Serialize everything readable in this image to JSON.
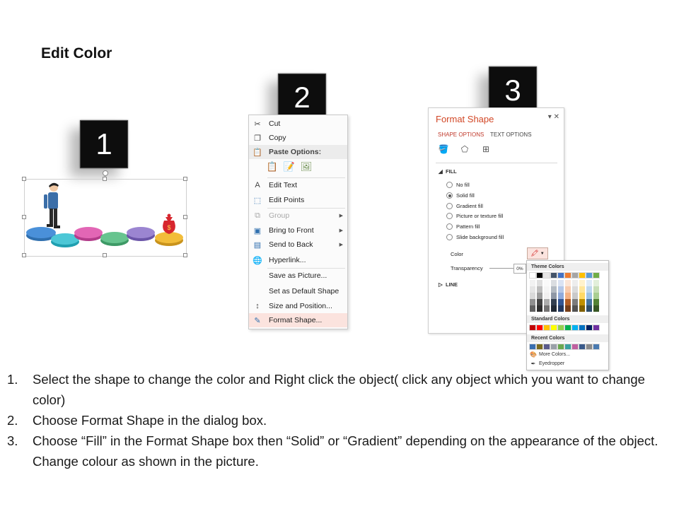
{
  "page": {
    "title": "Edit Color"
  },
  "badges": [
    "1",
    "2",
    "3"
  ],
  "illustration": {
    "money_bag_symbol": "$"
  },
  "context_menu": {
    "items": [
      {
        "label": "Cut",
        "icon": "scissors-icon"
      },
      {
        "label": "Copy",
        "icon": "copy-icon"
      },
      {
        "label": "Paste Options:",
        "icon": "paste-icon"
      },
      {
        "label": "Edit Text",
        "icon": "edit-text-icon"
      },
      {
        "label": "Edit Points",
        "icon": "edit-points-icon"
      },
      {
        "label": "Group",
        "icon": "group-icon"
      },
      {
        "label": "Bring to Front",
        "icon": "bring-front-icon"
      },
      {
        "label": "Send to Back",
        "icon": "send-back-icon"
      },
      {
        "label": "Hyperlink...",
        "icon": "hyperlink-icon"
      },
      {
        "label": "Save as Picture...",
        "icon": ""
      },
      {
        "label": "Set as Default Shape",
        "icon": ""
      },
      {
        "label": "Size and Position...",
        "icon": "size-position-icon"
      },
      {
        "label": "Format Shape...",
        "icon": "format-shape-icon"
      }
    ]
  },
  "format_shape": {
    "title": "Format Shape",
    "tabs": [
      "SHAPE OPTIONS",
      "TEXT OPTIONS"
    ],
    "fill_section": "FILL",
    "fill_options": [
      "No fill",
      "Solid fill",
      "Gradient fill",
      "Picture or texture fill",
      "Pattern fill",
      "Slide background fill"
    ],
    "selected_fill": "Solid fill",
    "color_label": "Color",
    "transparency_label": "Transparency",
    "transparency_value": "0%",
    "line_section": "LINE"
  },
  "color_popup": {
    "theme_header": "Theme Colors",
    "standard_header": "Standard Colors",
    "recent_header": "Recent Colors",
    "more_colors": "More Colors...",
    "eyedropper": "Eyedropper",
    "theme_top": [
      "#ffffff",
      "#000000",
      "#e7e6e6",
      "#44546a",
      "#4472c4",
      "#ed7d31",
      "#a5a5a5",
      "#ffc000",
      "#5b9bd5",
      "#70ad47"
    ],
    "standard": [
      "#c00000",
      "#ff0000",
      "#ffc000",
      "#ffff00",
      "#92d050",
      "#00b050",
      "#00b0f0",
      "#0070c0",
      "#002060",
      "#7030a0"
    ],
    "recent": [
      "#3a6fb0",
      "#7b6b1f",
      "#5a5a8a",
      "#9aa0a8",
      "#6aa84f",
      "#3aa0a0",
      "#c060a0",
      "#3a5a8a",
      "#8a8a8a",
      "#4a7ab0"
    ]
  },
  "instructions": [
    {
      "num": "1.",
      "text": "Select the shape to change the color and Right click the object( click any object which you want to change color)"
    },
    {
      "num": "2.",
      "text": "Choose Format Shape in the dialog box."
    },
    {
      "num": "3.",
      "text": "Choose “Fill” in the Format Shape box then “Solid” or “Gradient” depending on the appearance of the object. Change colour as shown in the picture."
    }
  ]
}
